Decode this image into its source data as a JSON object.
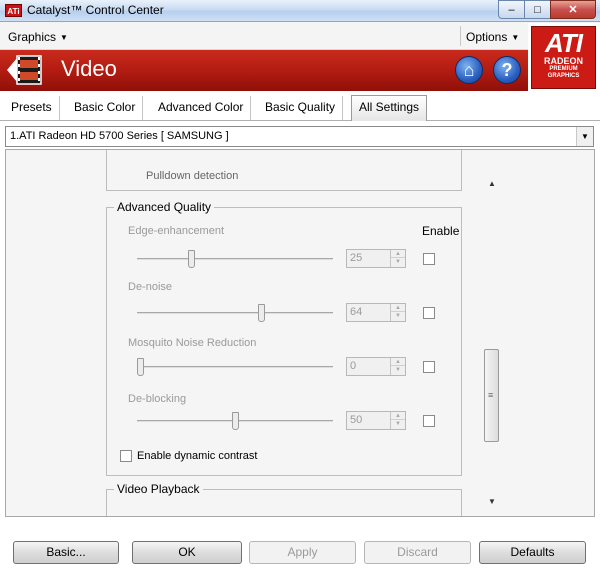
{
  "window": {
    "title": "Catalyst™ Control Center",
    "icon_text": "ATi",
    "min_glyph": "–",
    "max_glyph": "□",
    "close_glyph": "✕"
  },
  "menu": {
    "graphics": "Graphics",
    "options": "Options"
  },
  "banner": {
    "title": "Video",
    "home_glyph": "⌂",
    "help_glyph": "?"
  },
  "logo": {
    "brand": "ATI",
    "product": "RADEON",
    "tagline_1": "PREMIUM",
    "tagline_2": "GRAPHICS"
  },
  "tabs": [
    {
      "label": "Presets"
    },
    {
      "label": "Basic Color"
    },
    {
      "label": "Advanced Color"
    },
    {
      "label": "Basic Quality"
    },
    {
      "label": "All Settings",
      "active": true
    }
  ],
  "device": {
    "selected": "1.ATI Radeon HD 5700 Series [ SAMSUNG ]"
  },
  "panel": {
    "pulldown_label": "Pulldown detection",
    "advanced_quality": {
      "legend": "Advanced Quality",
      "enable_header": "Enable",
      "settings": [
        {
          "label": "Edge-enhancement",
          "value": "25",
          "slider_fraction": 0.27,
          "enabled": false
        },
        {
          "label": "De-noise",
          "value": "64",
          "slider_fraction": 0.64,
          "enabled": false
        },
        {
          "label": "Mosquito Noise Reduction",
          "value": "0",
          "slider_fraction": 0.0,
          "enabled": false
        },
        {
          "label": "De-blocking",
          "value": "50",
          "slider_fraction": 0.5,
          "enabled": false
        }
      ],
      "dynamic_contrast_label": "Enable dynamic contrast",
      "dynamic_contrast_checked": false
    },
    "video_playback_legend": "Video Playback",
    "scroll_fraction": 0.55
  },
  "buttons": {
    "basic": "Basic...",
    "ok": "OK",
    "apply": "Apply",
    "discard": "Discard",
    "defaults": "Defaults"
  },
  "colors": {
    "banner_red": "#b31c12",
    "accent_blue": "#2a5fc0"
  }
}
